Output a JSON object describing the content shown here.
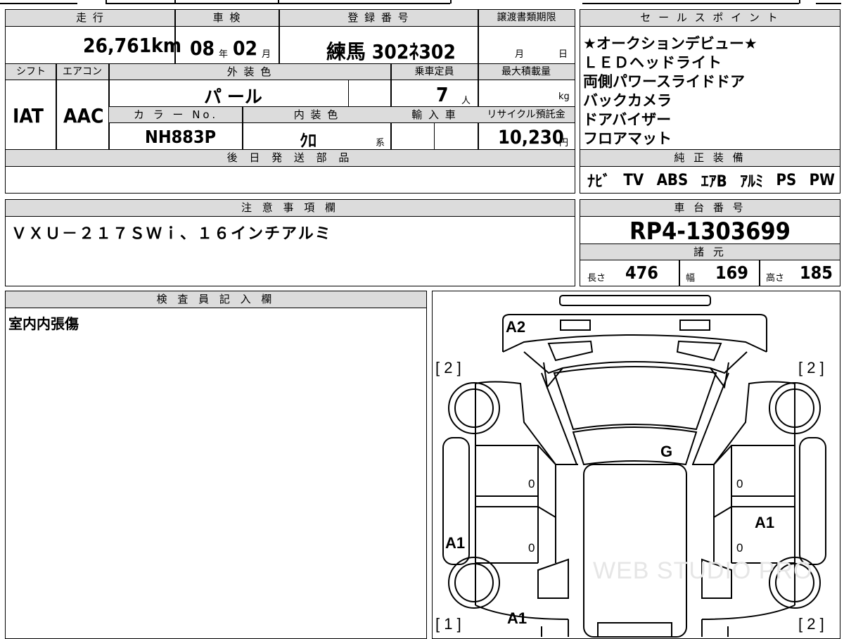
{
  "sheet": {
    "mileage_header": "走 行",
    "mileage": "26,761",
    "mileage_unit": "km",
    "inspection_header": "車 検",
    "inspection_year": "08",
    "inspection_year_unit": "年",
    "inspection_month": "02",
    "inspection_month_unit": "月",
    "registration_header": "登 録 番 号",
    "registration": "練馬  302ﾈ302",
    "transfer_header": "譲渡書類期限",
    "transfer_month": "月",
    "transfer_day": "日",
    "shift_header": "シフト",
    "shift": "IAT",
    "ac_header": "エアコン",
    "ac": "AAC",
    "exterior_header": "外 装 色",
    "exterior": "パ ール",
    "capacity_header": "乗車定員",
    "capacity": "7",
    "capacity_unit": "人",
    "max_load_header": "最大積載量",
    "max_load_unit": "kg",
    "color_no_header": "カ ラ ー No.",
    "color_no": "NH883P",
    "interior_header": "内 装 色",
    "interior": "ｸﾛ",
    "interior_unit": "系",
    "import_header": "輸 入 車",
    "recycle_header": "リサイクル預託金",
    "recycle": "10,230",
    "recycle_unit": "円",
    "later_parts_header": "後 日 発 送 部 品"
  },
  "sales_points": {
    "header": "セ ー ル ス ポ イ ン ト",
    "items": [
      "★オークションデビュー★",
      "ＬＥＤヘッドライト",
      "両側パワースライドドア",
      "バックカメラ",
      "ドアバイザー",
      "フロアマット"
    ]
  },
  "equipment": {
    "header": "純 正 装 備",
    "items": [
      "ﾅﾋﾞ",
      "TV",
      "ABS",
      "ｴｱB",
      "ｱﾙﾐ",
      "PS",
      "PW"
    ]
  },
  "notes": {
    "header": "注 意 事 項 欄",
    "text": "ＶＸＵ－２１７ＳＷｉ、１６インチアルミ"
  },
  "chassis": {
    "header": "車 台 番 号",
    "number": "RP4-1303699"
  },
  "specs": {
    "header": "諸 元",
    "length_label": "長さ",
    "length": "476",
    "width_label": "幅",
    "width": "169",
    "height_label": "高さ",
    "height": "185"
  },
  "inspector": {
    "header": "検 査 員 記 入 欄",
    "text": "室内内張傷"
  },
  "diagram": {
    "marks": {
      "front_bumper": "A2",
      "windshield": "G",
      "left_rear_door": "A1",
      "right_front_door": "A1",
      "rear_left": "A1"
    },
    "brackets": {
      "front_left": "[ 2 ]",
      "front_right": "[ 2 ]",
      "rear_left": "[ 1 ]",
      "rear_right": "[ 2 ]"
    },
    "zero": "0",
    "watermark": "WEB STUDIO PRO"
  }
}
